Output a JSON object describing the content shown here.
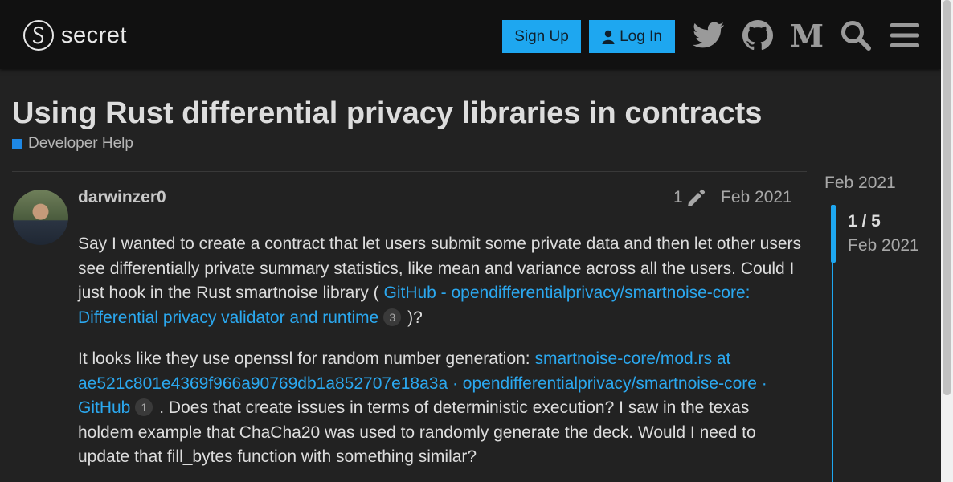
{
  "header": {
    "logo_text": "secret",
    "signup_label": "Sign Up",
    "login_label": "Log In",
    "medium_glyph": "M",
    "icons": [
      "twitter-icon",
      "github-icon",
      "medium-icon",
      "search-icon",
      "menu-icon"
    ]
  },
  "topic": {
    "title": "Using Rust differential privacy libraries in contracts",
    "category": "Developer Help",
    "category_color": "#1e88e5"
  },
  "post": {
    "username": "darwinzer0",
    "edit_count": "1",
    "date": "Feb 2021",
    "p1_text_a": "Say I wanted to create a contract that let users submit some private data and then let other users see differentially private summary statistics, like mean and variance across all the users. Could I just hook in the Rust smartnoise library ( ",
    "p1_link": "GitHub - opendifferentialprivacy/smartnoise-core: Differential privacy validator and runtime",
    "p1_link_clicks": "3",
    "p1_text_b": " )?",
    "p2_text_a": "It looks like they use openssl for random number generation: ",
    "p2_link": "smartnoise-core/mod.rs at ae521c801e4369f966a90769db1a852707e18a3a · opendifferentialprivacy/smartnoise-core · GitHub",
    "p2_link_clicks": "1",
    "p2_text_b": " . Does that create issues in terms of deterministic execution? I saw in the texas holdem example that ChaCha20 was used to randomly generate the deck. Would I need to update that fill_bytes function with something similar?"
  },
  "timeline": {
    "start_date": "Feb 2021",
    "position": "1 / 5",
    "current_date": "Feb 2021"
  },
  "colors": {
    "accent": "#1ea7f0",
    "background": "#222222",
    "header_bg": "#111111",
    "link": "#2ba8ef"
  }
}
